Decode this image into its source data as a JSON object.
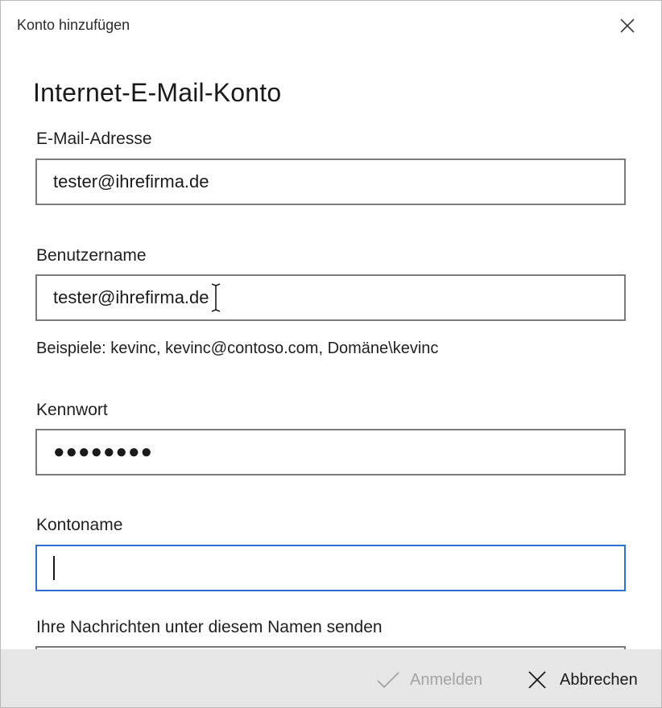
{
  "window": {
    "title": "Konto hinzufügen",
    "close_icon": "close-icon"
  },
  "form": {
    "heading": "Internet-E-Mail-Konto",
    "email": {
      "label": "E-Mail-Adresse",
      "value": "tester@ihrefirma.de"
    },
    "username": {
      "label": "Benutzername",
      "value": "tester@ihrefirma.de",
      "hint": "Beispiele: kevinc, kevinc@contoso.com, Domäne\\kevinc"
    },
    "password": {
      "label": "Kennwort",
      "masked_value": "●●●●●●●●"
    },
    "account_name": {
      "label": "Kontoname",
      "value": ""
    },
    "send_name": {
      "label": "Ihre Nachrichten unter diesem Namen senden"
    }
  },
  "footer": {
    "signin_label": "Anmelden",
    "signin_icon": "checkmark-icon",
    "cancel_label": "Abbrechen",
    "cancel_icon": "close-icon"
  },
  "colors": {
    "focus_border": "#2e6fd0",
    "footer_bg": "#e6e6e6",
    "disabled_text": "#a3a3a3"
  }
}
